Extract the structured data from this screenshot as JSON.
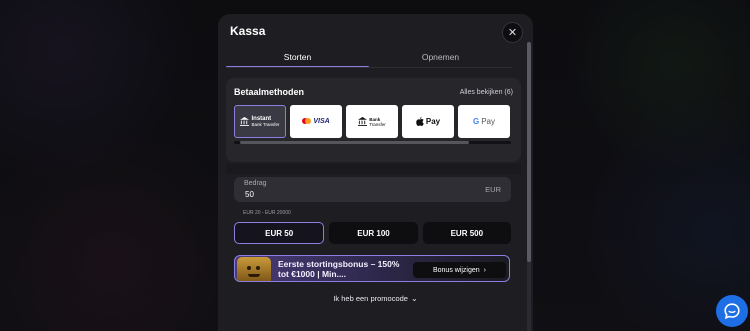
{
  "modal": {
    "title": "Kassa",
    "close_symbol": "✕"
  },
  "tabs": [
    {
      "label": "Storten",
      "active": true
    },
    {
      "label": "Opnemen",
      "active": false
    }
  ],
  "payment_methods": {
    "heading": "Betaalmethoden",
    "view_all": "Alles bekijken (6)",
    "items": [
      {
        "name": "Instant Bank Transfer",
        "line1": "Instant",
        "line2": "Bank Transfer",
        "icon": "bank-icon",
        "selected": true
      },
      {
        "name": "Mastercard Visa",
        "visa_text": "VISA",
        "icon": "mastercard-icon",
        "selected": false
      },
      {
        "name": "Bank Transfer",
        "line1": "Bank",
        "line2": "Transfer",
        "icon": "bank-icon",
        "selected": false
      },
      {
        "name": "Apple Pay",
        "text": "Pay",
        "icon": "apple-icon",
        "selected": false
      },
      {
        "name": "Google Pay",
        "g": "G",
        "text": "Pay",
        "icon": "google-icon",
        "selected": false
      }
    ]
  },
  "amount": {
    "label": "Bedrag",
    "value": "50",
    "currency": "EUR",
    "limits": "EUR 20 - EUR 20000"
  },
  "presets": [
    {
      "label": "EUR 50",
      "selected": true
    },
    {
      "label": "EUR 100",
      "selected": false
    },
    {
      "label": "EUR 500",
      "selected": false
    }
  ],
  "bonus": {
    "text": "Eerste stortingsbonus – 150% tot €1000 | Min....",
    "button_label": "Bonus wijzigen",
    "button_chevron": "›"
  },
  "promo": {
    "label": "Ik heb een promocode",
    "chevron": "⌄"
  },
  "colors": {
    "accent": "#8e7de0",
    "chat": "#1e6fe6",
    "modal_bg": "#1e1e22"
  }
}
